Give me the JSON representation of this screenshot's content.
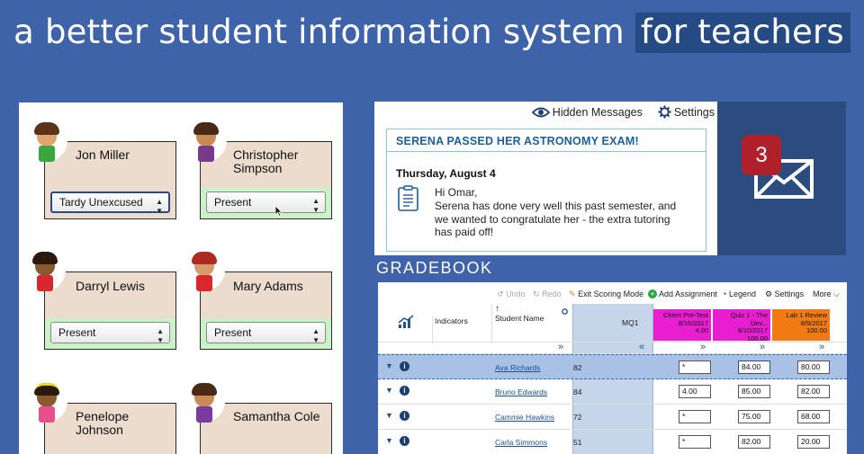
{
  "headline": {
    "prefix": "a better student information system ",
    "highlight": "for teachers"
  },
  "attendance": {
    "students": [
      {
        "name": "Jon Miller",
        "status": "Tardy Unexcused"
      },
      {
        "name": "Christopher Simpson",
        "status": "Present"
      },
      {
        "name": "Darryl Lewis",
        "status": "Present"
      },
      {
        "name": "Mary Adams",
        "status": "Present"
      },
      {
        "name": "Penelope Johnson",
        "status": ""
      },
      {
        "name": "Samantha Cole",
        "status": ""
      }
    ]
  },
  "messages": {
    "hidden_label": "Hidden Messages",
    "settings_label": "Settings",
    "subject": "SERENA PASSED HER ASTRONOMY EXAM!",
    "date": "Thursday, August 4",
    "greeting": "Hi Omar,",
    "body": "Serena has done very well this past semester, and we wanted to congratulate her - the extra tutoring has paid off!",
    "unread_count": "3"
  },
  "gradebook": {
    "title": "GRADEBOOK",
    "toolbar": {
      "undo": "Undo",
      "redo": "Redo",
      "exit": "Exit Scoring Mode",
      "add": "Add Assignment",
      "legend": "Legend",
      "settings": "Settings",
      "more": "More"
    },
    "columns": {
      "indicators": "Indicators",
      "student": "Student Name",
      "mq1": "MQ1"
    },
    "assignments": [
      {
        "name": "Chem Pre-Test",
        "date": "8/16/2017",
        "points": "4.00",
        "color": "#e91ed0"
      },
      {
        "name": "Quiz 1 - The Dev...",
        "date": "8/10/2017",
        "points": "100.00",
        "color": "#e91ed0"
      },
      {
        "name": "Lab 1 Review",
        "date": "8/9/2017",
        "points": "100.00",
        "color": "#f27a12"
      }
    ],
    "rows": [
      {
        "student": "Ava Richards",
        "mq1": "82",
        "scores": [
          "*",
          "84.00",
          "80.00"
        ]
      },
      {
        "student": "Bruno Edwards",
        "mq1": "84",
        "scores": [
          "4.00",
          "85.00",
          "82.00"
        ]
      },
      {
        "student": "Cammie Hawkins",
        "mq1": "72",
        "scores": [
          "*",
          "75.00",
          "68.00"
        ]
      },
      {
        "student": "Carla Simmons",
        "mq1": "51",
        "scores": [
          "*",
          "82.00",
          "20.00"
        ]
      }
    ]
  }
}
